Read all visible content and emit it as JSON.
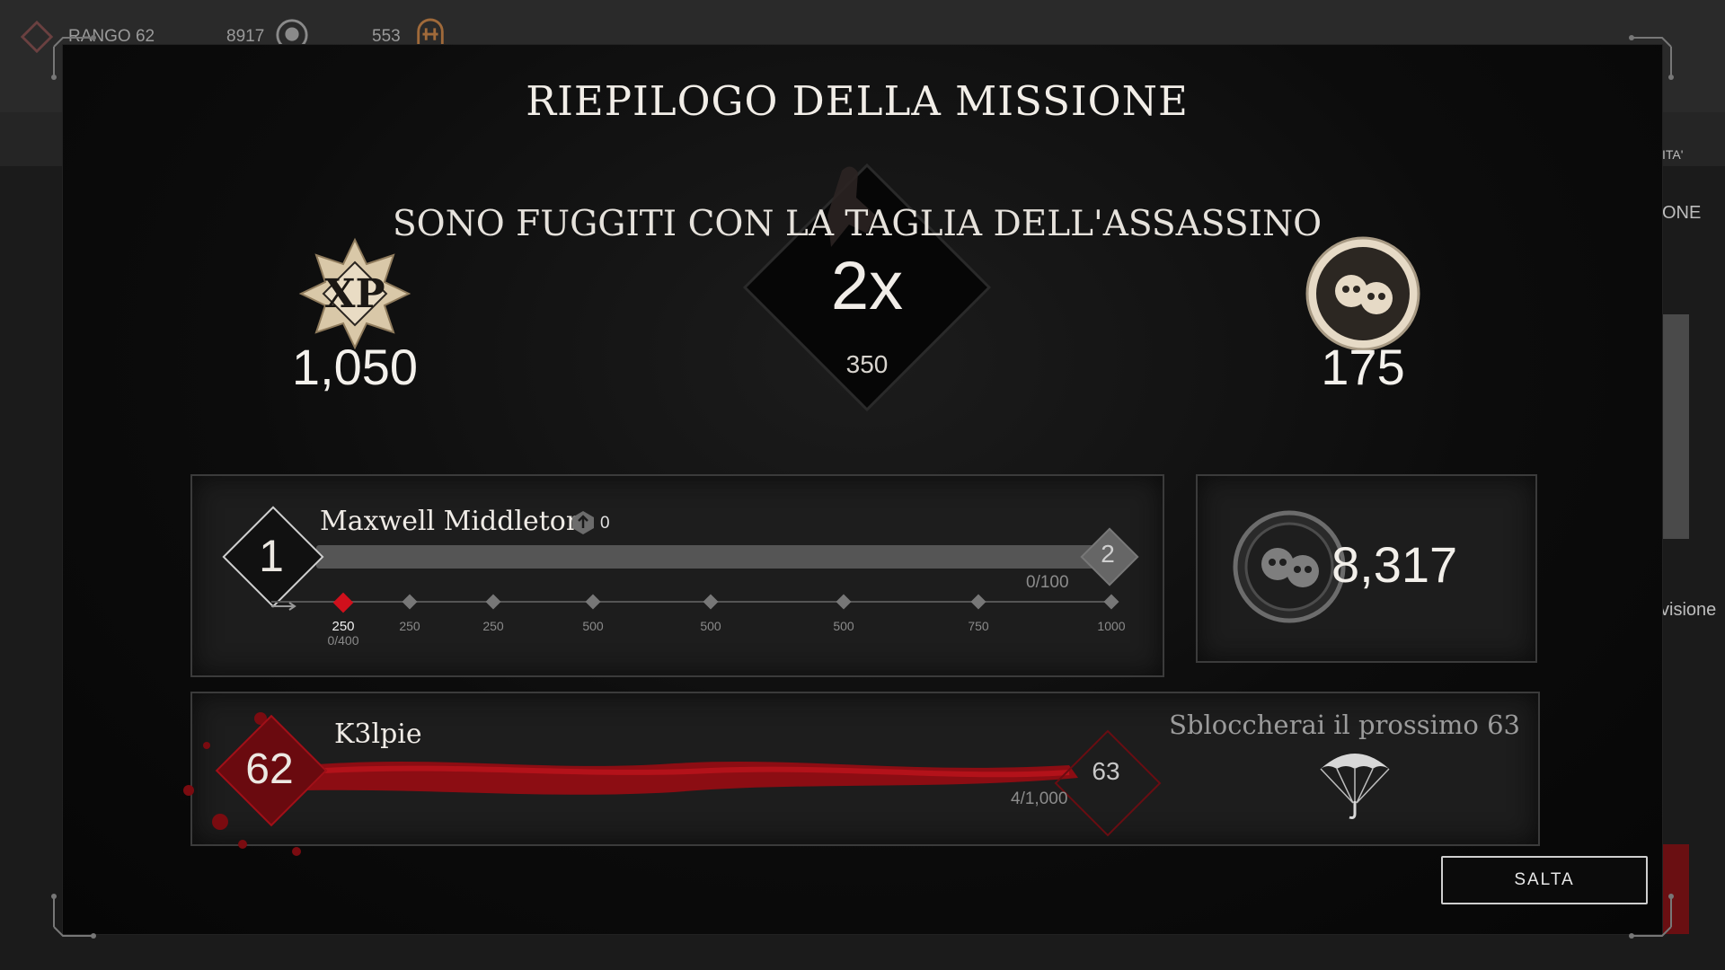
{
  "topbar": {
    "rank_label": "RANGO 62",
    "currency1": "8917",
    "currency2": "553"
  },
  "background": {
    "right_partial_1": "ITA'",
    "right_partial_2": "ONE",
    "right_partial_3": "visione"
  },
  "summary": {
    "title": "RIEPILOGO DELLA MISSIONE",
    "subtitle": "SONO FUGGITI CON LA TAGLIA DELL'ASSASSINO",
    "xp_badge_text": "XP",
    "xp_value": "1,050",
    "multiplier": "2x",
    "multiplier_sub": "350",
    "hunt_dollars": "175"
  },
  "hunter": {
    "name": "Maxwell Middleton",
    "prestige": "0",
    "level": "1",
    "next_level": "2",
    "progress_text": "0/100",
    "progress_fraction": 0,
    "milestones": [
      "250",
      "250",
      "250",
      "500",
      "500",
      "500",
      "750",
      "1000"
    ],
    "milestone_current_progress": "0/400"
  },
  "wallet": {
    "total": "8,317"
  },
  "account": {
    "name": "K3lpie",
    "level": "62",
    "next_level": "63",
    "progress_text": "4/1,000",
    "unlock_text": "Sbloccherai il prossimo 63"
  },
  "buttons": {
    "skip": "SALTA"
  },
  "colors": {
    "accent_red": "#c8121c",
    "panel_border": "#3b3b3b"
  }
}
